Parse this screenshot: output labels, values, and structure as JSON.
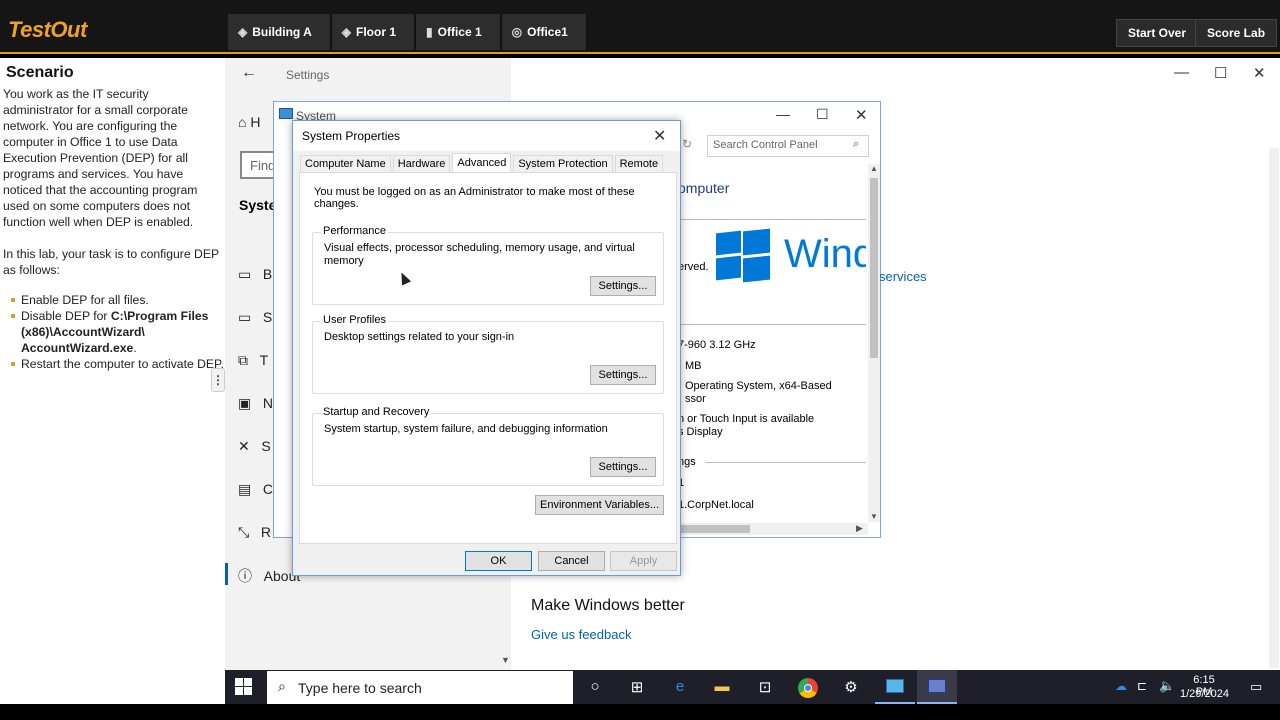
{
  "topbar": {
    "logo": "TestOut",
    "crumbs": [
      "Building A",
      "Floor 1",
      "Office 1",
      "Office1"
    ],
    "start_over": "Start Over",
    "score_lab": "Score Lab"
  },
  "scenario": {
    "heading": "Scenario",
    "p1": "You work as the IT security administrator for a small corporate network. You are configuring the computer in Office 1 to use Data Execution Prevention (DEP) for all programs and services. You have noticed that the accounting program used on some computers does not function well when DEP is enabled.",
    "p2": "In this lab, your task is to configure DEP as follows:",
    "tasks": {
      "t1": "Enable DEP for all files.",
      "t2a": "Disable DEP for ",
      "t2b": "C:\\Program Files (x86)\\AccountWizard\\ AccountWizard.exe",
      "t2c": ".",
      "t3": "Restart the computer to activate DEP."
    }
  },
  "settings": {
    "title": "Settings",
    "nav": [
      "H",
      "Find",
      "Syste",
      "B",
      "S",
      "T",
      "N",
      "S",
      "C",
      "R",
      "About"
    ],
    "make_better": "Make Windows better",
    "feedback": "Give us feedback"
  },
  "system_window": {
    "title": "System",
    "search_placeholder": "Search Control Panel",
    "computer": "omputer",
    "windows_text": "Wind",
    "reserved": "erved.",
    "services": "services",
    "cpu": "7-960  3.12 GHz",
    "mem": "MB",
    "os": "Operating System, x64-Based",
    "ossub": "ssor",
    "touch": "n or Touch Input is available",
    "touch2": "s Display",
    "ngs": "ngs",
    "one": "1",
    "domain": "1.CorpNet.local"
  },
  "dialog": {
    "title": "System Properties",
    "tabs": [
      "Computer Name",
      "Hardware",
      "Advanced",
      "System Protection",
      "Remote"
    ],
    "notice": "You must be logged on as an Administrator to make most of these changes.",
    "perf_label": "Performance",
    "perf_desc": "Visual effects, processor scheduling, memory usage, and virtual memory",
    "profiles_label": "User Profiles",
    "profiles_desc": "Desktop settings related to your sign-in",
    "startup_label": "Startup and Recovery",
    "startup_desc": "System startup, system failure, and debugging information",
    "settings_btn": "Settings...",
    "env_btn": "Environment Variables...",
    "ok": "OK",
    "cancel": "Cancel",
    "apply": "Apply"
  },
  "taskbar": {
    "search": "Type here to search",
    "time": "6:15 PM",
    "date": "1/29/2024"
  }
}
